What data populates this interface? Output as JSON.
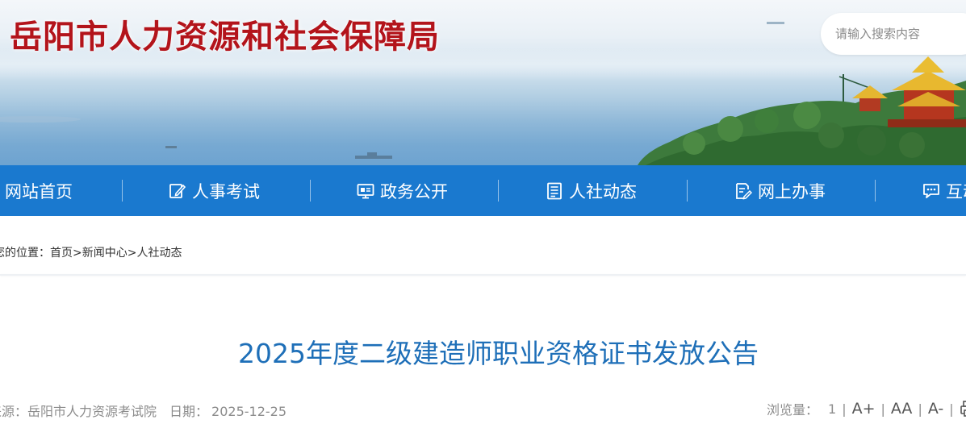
{
  "header": {
    "site_title": "岳阳市人力资源和社会保障局",
    "search_placeholder": "请输入搜索内容"
  },
  "nav": {
    "items": [
      {
        "label": "网站首页",
        "icon": "home-icon"
      },
      {
        "label": "人事考试",
        "icon": "edit-icon"
      },
      {
        "label": "政务公开",
        "icon": "monitor-icon"
      },
      {
        "label": "人社动态",
        "icon": "document-list-icon"
      },
      {
        "label": "网上办事",
        "icon": "form-edit-icon"
      },
      {
        "label": "互动",
        "icon": "chat-icon"
      }
    ]
  },
  "breadcrumb": {
    "prefix": "您的位置：",
    "items": [
      "首页",
      "新闻中心",
      "人社动态"
    ],
    "separator": ">"
  },
  "article": {
    "title": "2025年度二级建造师职业资格证书发放公告",
    "source_label": "来源：",
    "source": "岳阳市人力资源考试院",
    "date_label": "日期：",
    "date": "2025-12-25",
    "views_label": "浏览量：",
    "views": "1",
    "font_larger": "A+",
    "font_reset": "AA",
    "font_smaller": "A-"
  },
  "colors": {
    "title_red": "#b3141b",
    "nav_blue": "#1a79cf",
    "article_title_blue": "#1e6fb8",
    "meta_gray": "#8c8c8c"
  }
}
